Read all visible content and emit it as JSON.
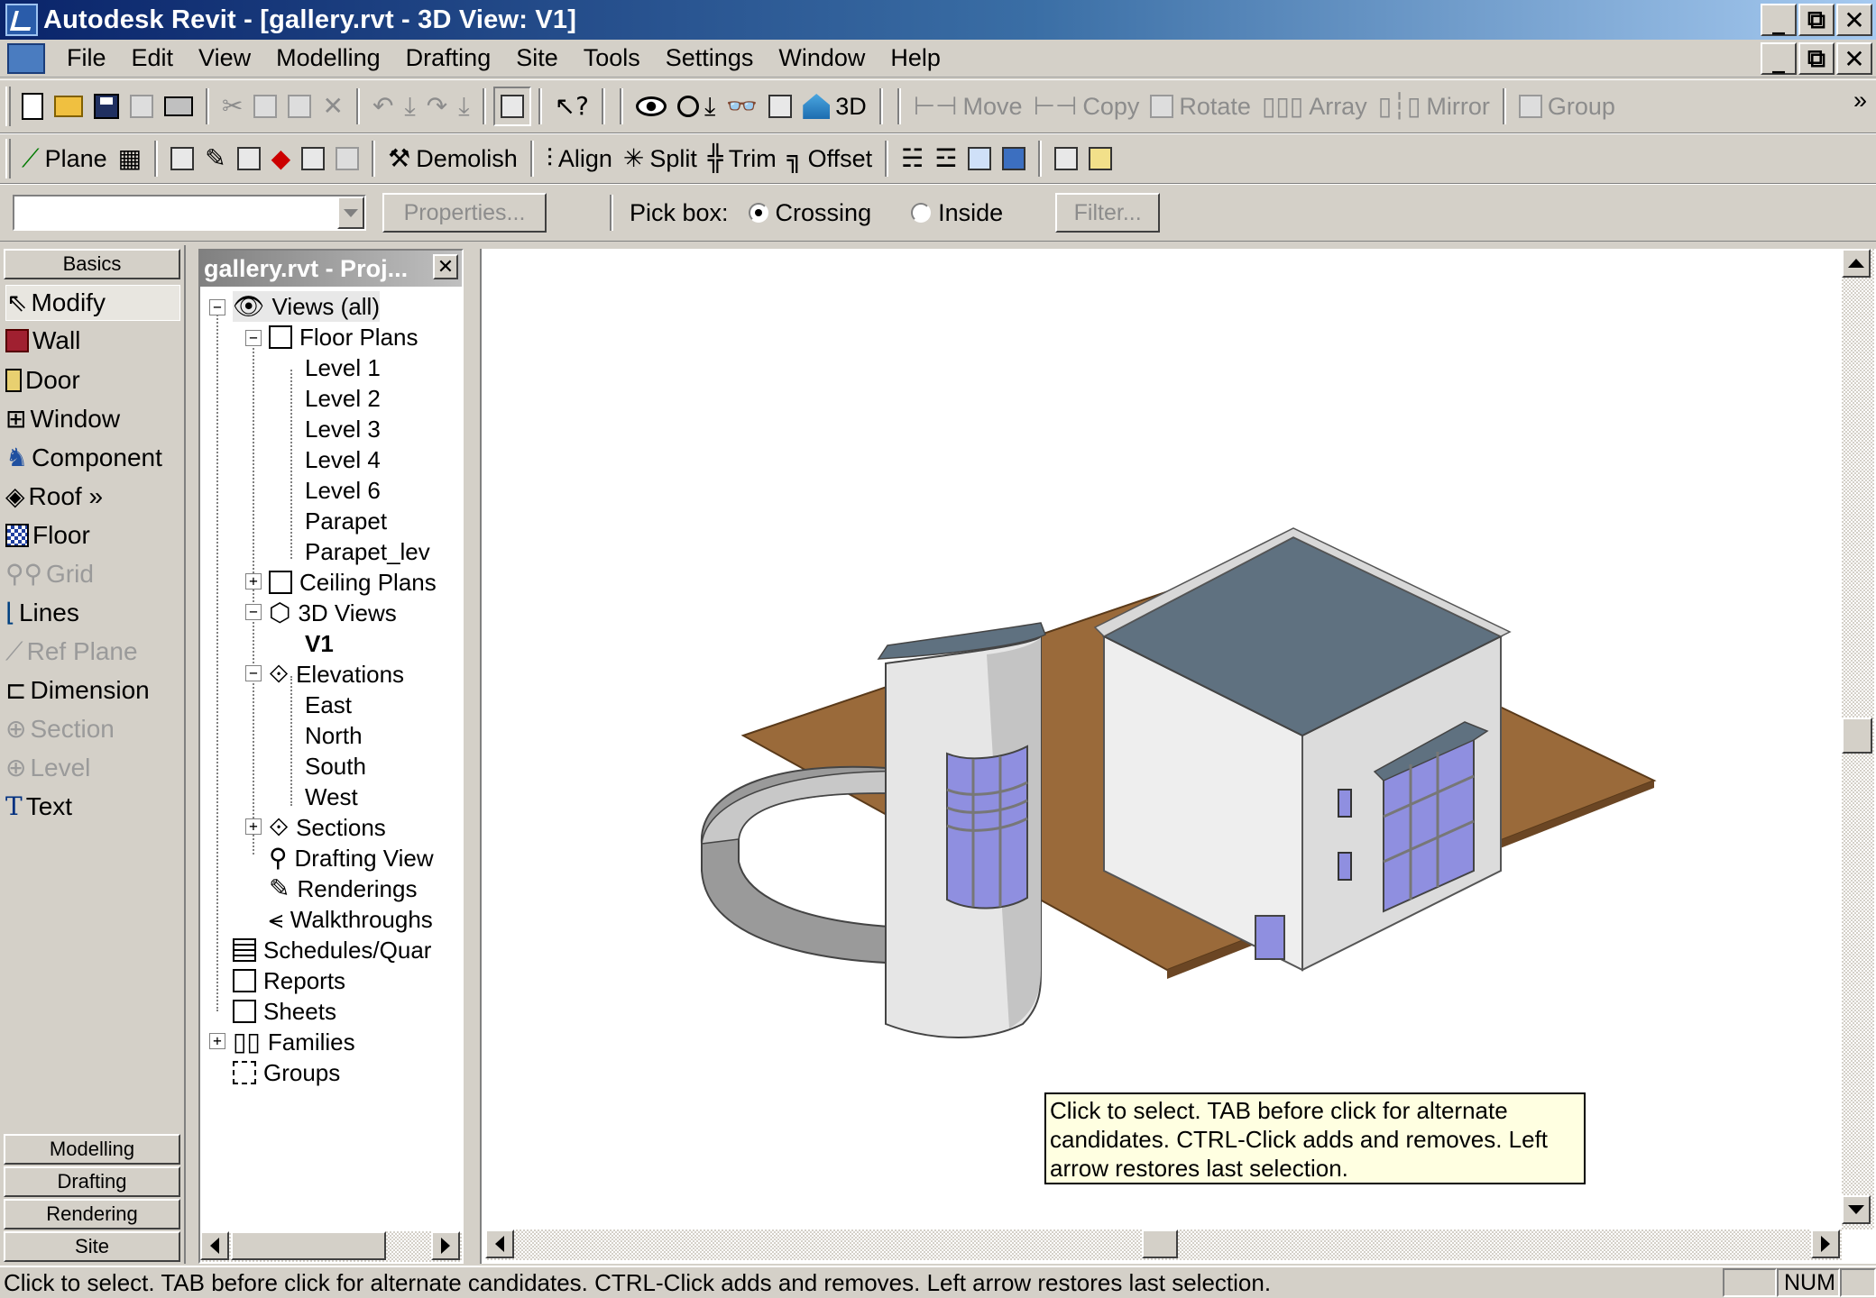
{
  "window": {
    "title": "Autodesk Revit - [gallery.rvt - 3D View: V1]",
    "min": "_",
    "restore": "⧉",
    "close": "✕"
  },
  "menu": [
    "File",
    "Edit",
    "View",
    "Modelling",
    "Drafting",
    "Site",
    "Tools",
    "Settings",
    "Window",
    "Help"
  ],
  "toolbar1": {
    "view3d_label": "3D",
    "move": "Move",
    "copy": "Copy",
    "rotate": "Rotate",
    "array": "Array",
    "mirror": "Mirror",
    "group": "Group",
    "overflow": "»"
  },
  "toolbar2": {
    "plane": "Plane",
    "demolish": "Demolish",
    "align": "Align",
    "split": "Split",
    "trim": "Trim",
    "offset": "Offset"
  },
  "options_bar": {
    "type_value": "",
    "properties": "Properties...",
    "pick_box_label": "Pick box:",
    "crossing": "Crossing",
    "inside": "Inside",
    "filter": "Filter...",
    "selected": "Crossing"
  },
  "palette": {
    "basics": "Basics",
    "items": [
      {
        "label": "Modify",
        "icon": "arrow-cursor-icon",
        "enabled": true
      },
      {
        "label": "Wall",
        "icon": "wall-icon",
        "enabled": true
      },
      {
        "label": "Door",
        "icon": "door-icon",
        "enabled": true
      },
      {
        "label": "Window",
        "icon": "window-icon",
        "enabled": true
      },
      {
        "label": "Component",
        "icon": "component-icon",
        "enabled": true
      },
      {
        "label": "Roof »",
        "icon": "roof-icon",
        "enabled": true
      },
      {
        "label": "Floor",
        "icon": "floor-icon",
        "enabled": true
      },
      {
        "label": "Grid",
        "icon": "grid-icon",
        "enabled": false
      },
      {
        "label": "Lines",
        "icon": "lines-icon",
        "enabled": true
      },
      {
        "label": "Ref Plane",
        "icon": "ref-plane-icon",
        "enabled": false
      },
      {
        "label": "Dimension",
        "icon": "dimension-icon",
        "enabled": true
      },
      {
        "label": "Section",
        "icon": "section-icon",
        "enabled": false
      },
      {
        "label": "Level",
        "icon": "level-icon",
        "enabled": false
      },
      {
        "label": "Text",
        "icon": "text-icon",
        "enabled": true
      }
    ],
    "tabs": [
      "Modelling",
      "Drafting",
      "Rendering",
      "Site"
    ]
  },
  "browser": {
    "title": "gallery.rvt - Proj...",
    "close": "✕",
    "tree": {
      "views_all": "Views (all)",
      "floor_plans": "Floor Plans",
      "levels": [
        "Level 1",
        "Level 2",
        "Level 3",
        "Level 4",
        "Level 6",
        "Parapet",
        "Parapet_lev"
      ],
      "ceiling_plans": "Ceiling Plans",
      "views_3d": "3D Views",
      "v1": "V1",
      "elevations": "Elevations",
      "elevation_items": [
        "East",
        "North",
        "South",
        "West"
      ],
      "sections": "Sections",
      "drafting_views": "Drafting View",
      "renderings": "Renderings",
      "walkthroughs": "Walkthroughs",
      "schedules": "Schedules/Quar",
      "reports": "Reports",
      "sheets": "Sheets",
      "families": "Families",
      "groups": "Groups"
    }
  },
  "tooltip": "Click to select. TAB before click for alternate candidates. CTRL-Click adds and removes. Left arrow restores last selection.",
  "status": {
    "text": "Click to select. TAB before click for alternate candidates. CTRL-Click adds and removes. Left arrow restores last selection.",
    "num": "NUM"
  },
  "colors": {
    "title_start": "#0a246a",
    "roof": "#5f7180",
    "ground": "#9a6a3a",
    "glass": "#8f8fe0",
    "wall": "#e6e6e6"
  }
}
